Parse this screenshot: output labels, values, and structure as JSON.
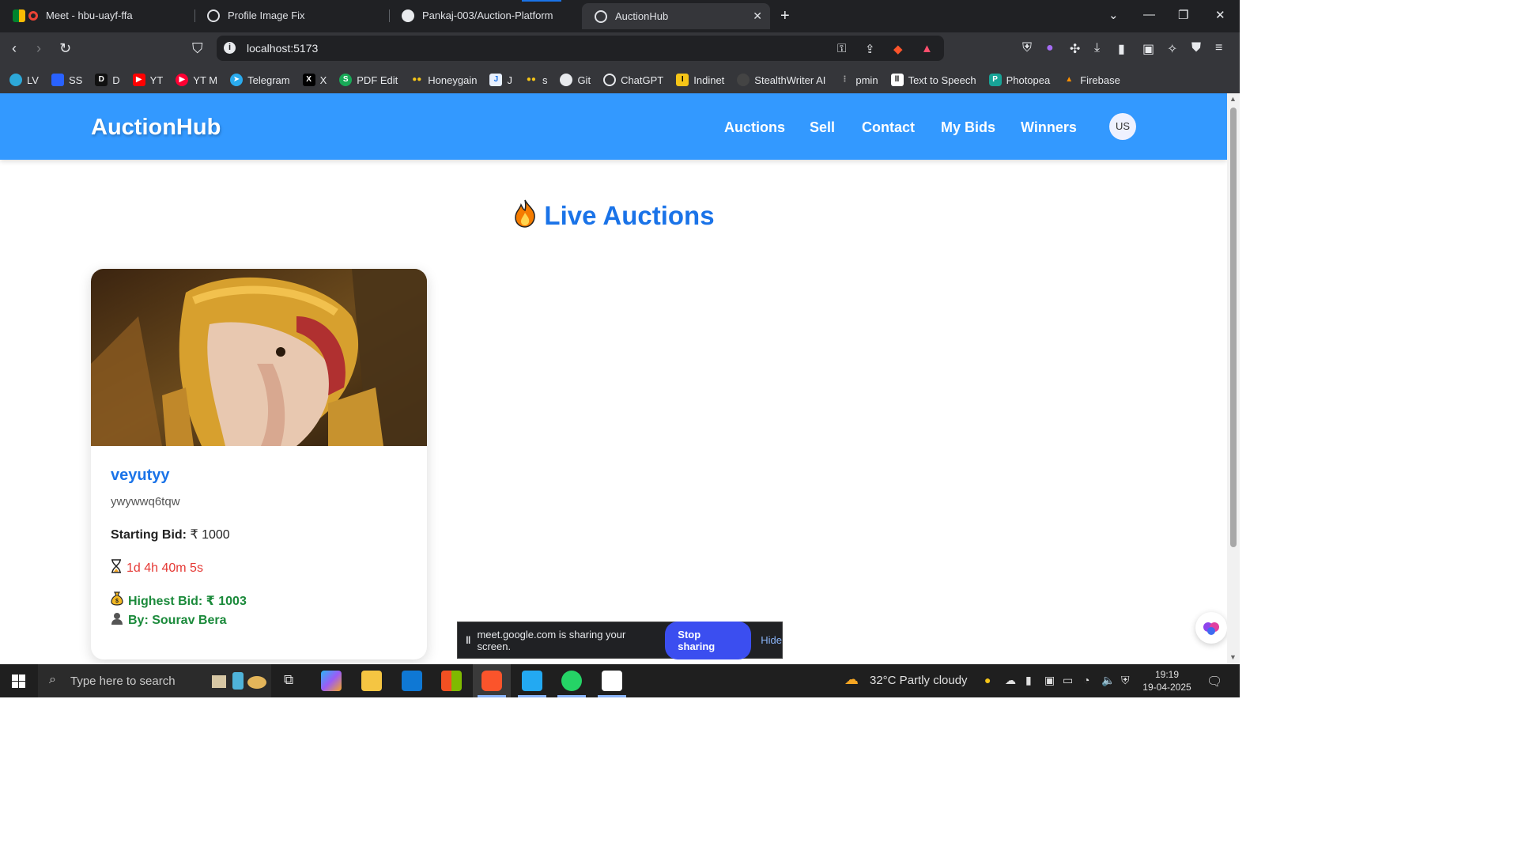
{
  "browser": {
    "tabs": [
      {
        "title": "Meet - hbu-uayf-ffa"
      },
      {
        "title": "Profile Image Fix"
      },
      {
        "title": "Pankaj-003/Auction-Platform"
      },
      {
        "title": "AuctionHub"
      }
    ],
    "url": "localhost:5173",
    "bookmarks": [
      "LV",
      "SS",
      "D",
      "YT",
      "YT M",
      "Telegram",
      "X",
      "PDF Edit",
      "Honeygain",
      "J",
      "s",
      "Git",
      "ChatGPT",
      "Indinet",
      "StealthWriter AI",
      "pmin",
      "Text to Speech",
      "Photopea",
      "Firebase"
    ]
  },
  "app": {
    "brand": "AuctionHub",
    "nav": [
      "Auctions",
      "Sell",
      "Contact",
      "My Bids",
      "Winners"
    ],
    "avatar": "US",
    "page_title": "Live Auctions"
  },
  "auction": {
    "title": "veyutyy",
    "description": "ywywwq6tqw",
    "starting_bid_label": "Starting Bid:",
    "starting_bid_value": "₹ 1000",
    "timer": "1d 4h 40m 5s",
    "highest_bid": "Highest Bid: ₹ 1003",
    "bidder": "By: Sourav Bera"
  },
  "share_bar": {
    "message": "meet.google.com is sharing your screen.",
    "stop_label": "Stop sharing",
    "hide_label": "Hide"
  },
  "taskbar": {
    "search_placeholder": "Type here to search",
    "weather": "32°C  Partly cloudy",
    "time": "19:19",
    "date": "19-04-2025"
  },
  "colors": {
    "app_nav": "#3399ff",
    "title_blue": "#1a73e8",
    "timer_red": "#e53935",
    "bid_green": "#1b8a3b",
    "stop_button": "#3b4ef0"
  }
}
